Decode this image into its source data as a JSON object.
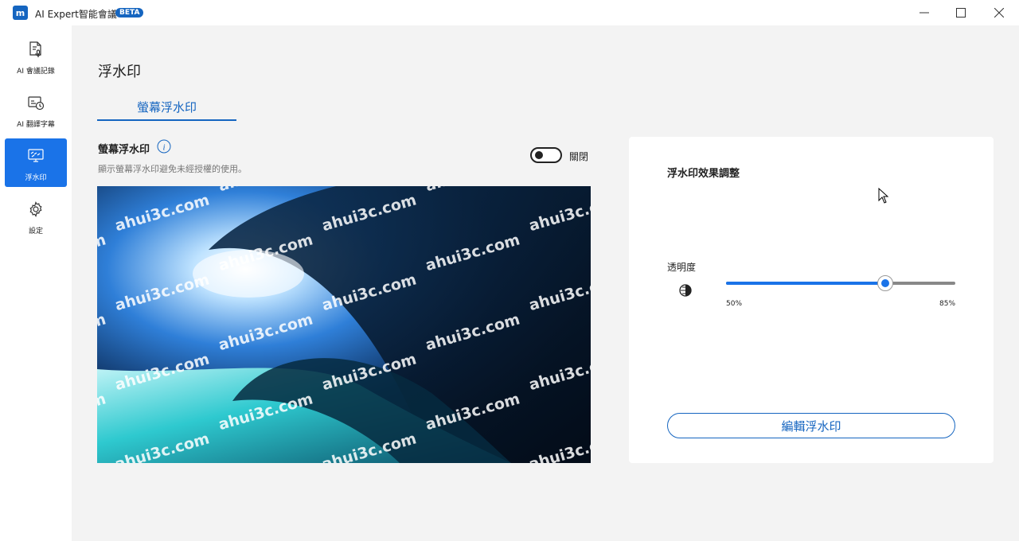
{
  "titlebar": {
    "logo_letter": "m",
    "app_title": "AI Expert智能會議",
    "badge": "BETA"
  },
  "sidebar": {
    "items": [
      {
        "label": "AI 會議記錄",
        "icon": "document-mic-icon",
        "active": false
      },
      {
        "label": "AI 翻譯字幕",
        "icon": "subtitle-clock-icon",
        "active": false
      },
      {
        "label": "浮水印",
        "icon": "watermark-monitor-icon",
        "active": true
      },
      {
        "label": "設定",
        "icon": "gear-icon",
        "active": false
      }
    ]
  },
  "main": {
    "page_title": "浮水印",
    "tab_label": "螢幕浮水印",
    "section_label": "螢幕浮水印",
    "section_desc": "顯示螢幕浮水印避免未經授權的使用。",
    "toggle_label": "關閉",
    "toggle_on": false,
    "watermark_text": "ahui3c.com"
  },
  "panel": {
    "title": "浮水印效果調整",
    "opacity_label": "透明度",
    "slider_min_label": "50%",
    "slider_max_label": "85%",
    "slider_value_fraction": 0.695,
    "edit_button": "編輯浮水印"
  },
  "colors": {
    "accent": "#1a73e8",
    "accent_dark": "#1565c0",
    "background": "#f3f3f3"
  }
}
